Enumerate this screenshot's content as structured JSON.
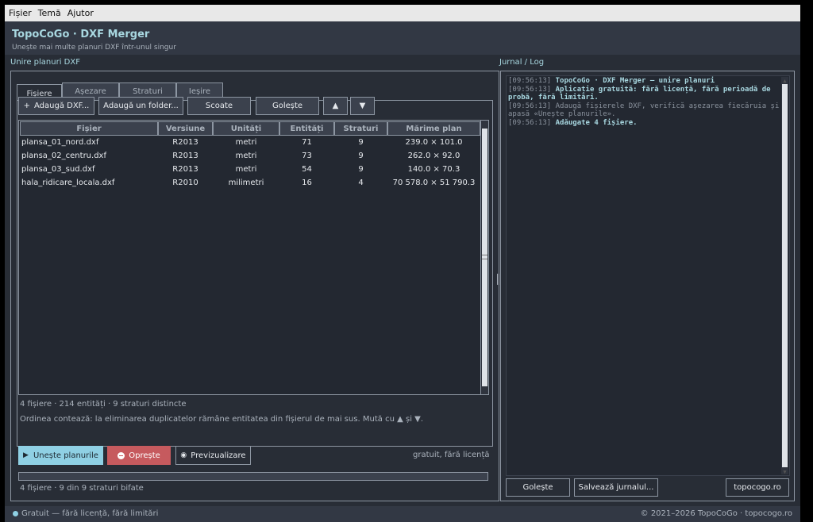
{
  "menu": [
    "Fișier",
    "Temă",
    "Ajutor"
  ],
  "app": {
    "title": "TopoCoGo · DXF Merger",
    "subtitle": "Unește mai multe planuri DXF într-unul singur"
  },
  "left_section_label": "Unire planuri DXF",
  "right_section_label": "Jurnal / Log",
  "tabs": [
    "Fișiere",
    "Așezare",
    "Straturi",
    "Ieșire"
  ],
  "toolbar": {
    "add_file": "Adaugă DXF...",
    "add_folder": "Adaugă un folder...",
    "remove": "Scoate",
    "clear": "Golește",
    "up": "▲",
    "down": "▼"
  },
  "table": {
    "columns": [
      "Fișier",
      "Versiune",
      "Unități",
      "Entități",
      "Straturi",
      "Mărime plan"
    ],
    "rows": [
      [
        "plansa_01_nord.dxf",
        "R2013",
        "metri",
        "71",
        "9",
        "239.0 × 101.0"
      ],
      [
        "plansa_02_centru.dxf",
        "R2013",
        "metri",
        "73",
        "9",
        "262.0 × 92.0"
      ],
      [
        "plansa_03_sud.dxf",
        "R2013",
        "metri",
        "54",
        "9",
        "140.0 × 70.3"
      ],
      [
        "hala_ridicare_locala.dxf",
        "R2010",
        "milimetri",
        "16",
        "4",
        "70 578.0 × 51 790.3"
      ]
    ]
  },
  "summary": "4 fișiere  ·  214 entități  ·  9 straturi distincte",
  "order_note": "Ordinea contează: la eliminarea duplicatelor rămâne entitatea din fișierul de mai sus. Mută cu ▲ și ▼.",
  "actions": {
    "merge": "Unește planurile",
    "stop": "Oprește",
    "preview": "Previzualizare",
    "license_note": "gratuit, fără licență"
  },
  "progress": {
    "value": 0
  },
  "status_line": "4 fișiere  ·  9 din 9 straturi bifate",
  "log": [
    {
      "ts": "[09:56:13]",
      "text": "TopoCoGo · DXF Merger — unire planuri",
      "style": "bold"
    },
    {
      "ts": "[09:56:13]",
      "text": "Aplicație gratuită: fără licență, fără perioadă de probă, fără limitări.",
      "style": "bold"
    },
    {
      "ts": "[09:56:13]",
      "text": "Adaugă fișierele DXF, verifică așezarea fiecăruia și apasă «Unește planurile».",
      "style": "normal"
    },
    {
      "ts": "[09:56:13]",
      "text": "Adăugate 4 fișiere.",
      "style": "bold"
    }
  ],
  "log_buttons": {
    "clear": "Golește",
    "save": "Salvează jurnalul...",
    "site": "topocogo.ro"
  },
  "footer": {
    "left": "Gratuit — fără licență, fără limitări",
    "right": "© 2021–2026 TopoCoGo · topocogo.ro"
  },
  "colors": {
    "accent": "#a8d7e0",
    "merge_button": "#8fd0e4",
    "stop_button": "#c65a5e"
  }
}
